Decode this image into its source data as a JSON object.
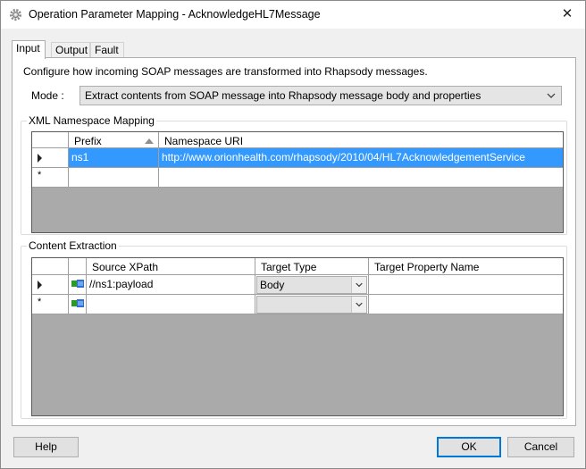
{
  "window": {
    "title": "Operation Parameter Mapping - AcknowledgeHL7Message",
    "close_glyph": "✕"
  },
  "tabs": [
    {
      "label": "Input",
      "active": true
    },
    {
      "label": "Output",
      "active": false
    },
    {
      "label": "Fault",
      "active": false
    }
  ],
  "input": {
    "description": "Configure how incoming SOAP messages are transformed into Rhapsody messages.",
    "mode_label": "Mode :",
    "mode_value": "Extract contents from SOAP message into Rhapsody message body and properties"
  },
  "namespace_mapping": {
    "title": "XML Namespace Mapping",
    "columns": [
      "Prefix",
      "Namespace URI"
    ],
    "rows": [
      {
        "prefix": "ns1",
        "uri": "http://www.orionhealth.com/rhapsody/2010/04/HL7AcknowledgementService",
        "selected": true
      }
    ],
    "new_row_marker": "*"
  },
  "content_extraction": {
    "title": "Content Extraction",
    "columns": [
      "Source XPath",
      "Target Type",
      "Target Property Name"
    ],
    "rows": [
      {
        "xpath": "//ns1:payload",
        "target_type": "Body",
        "property": ""
      }
    ],
    "new_row_marker": "*"
  },
  "buttons": {
    "help": "Help",
    "ok": "OK",
    "cancel": "Cancel"
  },
  "colors": {
    "selection": "#3399ff",
    "accent": "#0078d7"
  }
}
